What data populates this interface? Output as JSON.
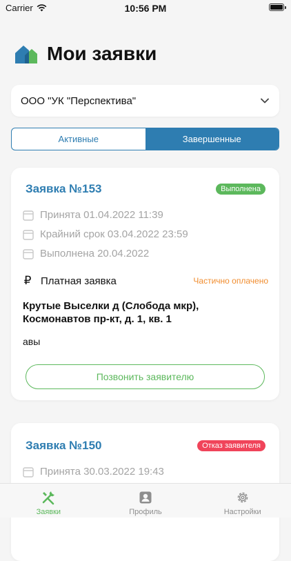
{
  "status_bar": {
    "carrier": "Carrier",
    "time": "10:56 PM"
  },
  "header": {
    "title": "Мои заявки"
  },
  "org_select": {
    "value": "ООО \"УК \"Перспектива\""
  },
  "tabs": [
    {
      "label": "Активные"
    },
    {
      "label": "Завершенные"
    }
  ],
  "requests": [
    {
      "title": "Заявка №153",
      "status": "Выполнена",
      "accepted": "Принята 01.04.2022 11:39",
      "deadline": "Крайний срок 03.04.2022 23:59",
      "completed": "Выполнена 20.04.2022",
      "paid_label": "Платная заявка",
      "paid_status": "Частично оплачено",
      "address": "Крутые Выселки д (Слобода мкр), Космонавтов пр-кт, д. 1, кв. 1",
      "note": "авы",
      "call_label": "Позвонить заявителю"
    },
    {
      "title": "Заявка №150",
      "status": "Отказ заявителя",
      "accepted": "Принята 30.03.2022 19:43"
    }
  ],
  "bottom_nav": [
    {
      "label": "Заявки"
    },
    {
      "label": "Профиль"
    },
    {
      "label": "Настройки"
    }
  ],
  "colors": {
    "accent": "#2e7db1",
    "success": "#5cb85c",
    "warning": "#f08c2e",
    "danger": "#f0445a"
  }
}
